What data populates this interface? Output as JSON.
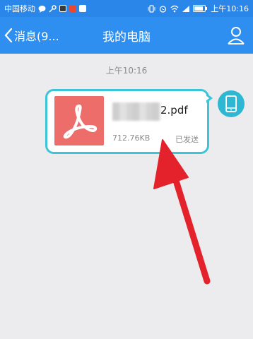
{
  "status_bar": {
    "carrier": "中国移动",
    "battery": "",
    "time": "上午10:16"
  },
  "header": {
    "back_label": "消息(9...",
    "title": "我的电脑"
  },
  "chat": {
    "timestamp": "上午10:16",
    "message": {
      "file_name_suffix": "2.pdf",
      "file_size": "712.76KB",
      "status": "已发送"
    }
  },
  "colors": {
    "header_bg": "#2f8ff0",
    "bubble_border": "#3cc4d8",
    "pdf_red": "#ec6d6a",
    "annotation_arrow": "#e3222b"
  }
}
